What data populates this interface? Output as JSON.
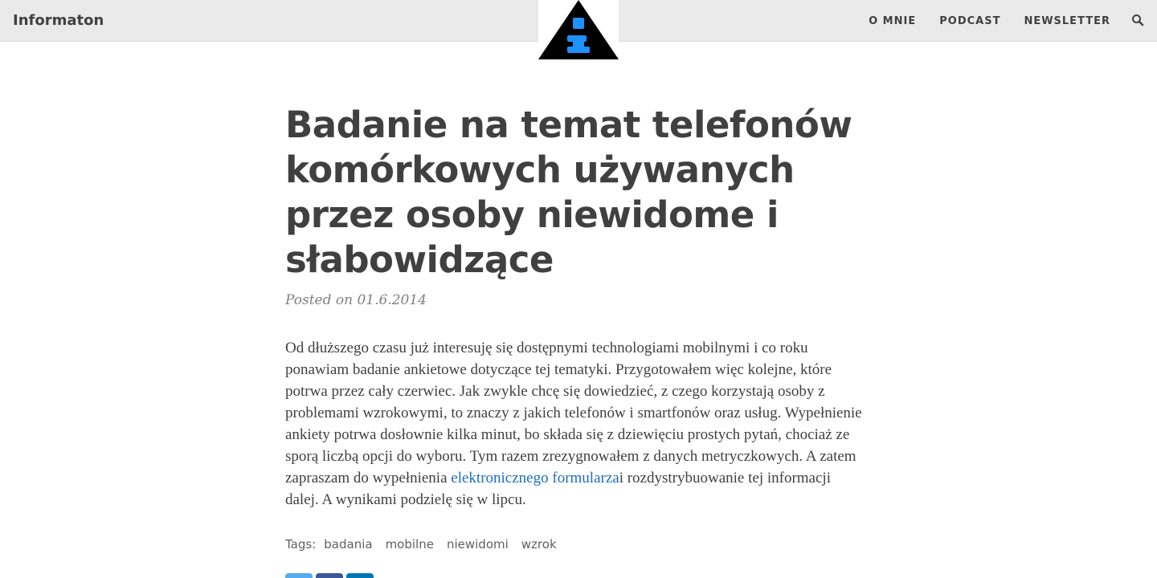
{
  "header": {
    "site_title": "Informaton",
    "nav": [
      {
        "label": "O MNIE"
      },
      {
        "label": "PODCAST"
      },
      {
        "label": "NEWSLETTER"
      }
    ],
    "search_icon": "search-icon",
    "logo": {
      "icon": "info-triangle-logo",
      "colors": {
        "triangle": "#000000",
        "letter": "#1e90ff"
      }
    }
  },
  "post": {
    "title": "Badanie na temat telefonów komórkowych używanych przez osoby niewidome i słabowidzące",
    "meta": "Posted on 01.6.2014",
    "body_before_link": "Od dłuższego czasu już interesuję się dostępnymi technologiami mobilnymi i co roku ponawiam badanie ankietowe dotyczące tej tematyki. Przygotowałem więc kolejne, które potrwa przez cały czerwiec. Jak zwykle chcę się dowiedzieć, z czego korzystają osoby z problemami wzrokowymi, to znaczy z jakich telefonów i smartfonów oraz usług. Wypełnienie ankiety potrwa dosłownie kilka minut, bo składa się z dziewięciu prostych pytań, chociaż ze sporą liczbą opcji do wyboru. Tym razem zrezygnowałem z danych metryczkowych. A zatem zapraszam do wypełnienia ",
    "body_link": "elektronicznego formularza",
    "body_after_link": "i rozdystrybuowanie tej informacji dalej. A wynikami podzielę się w lipcu.",
    "tags_label": "Tags:",
    "tags": [
      "badania",
      "mobilne",
      "niewidomi",
      "wzrok"
    ]
  },
  "share": {
    "buttons": [
      {
        "icon": "twitter-icon",
        "color": "#55acee"
      },
      {
        "icon": "facebook-icon",
        "color": "#3b5998"
      },
      {
        "icon": "linkedin-icon",
        "color": "#0077b5"
      }
    ]
  }
}
